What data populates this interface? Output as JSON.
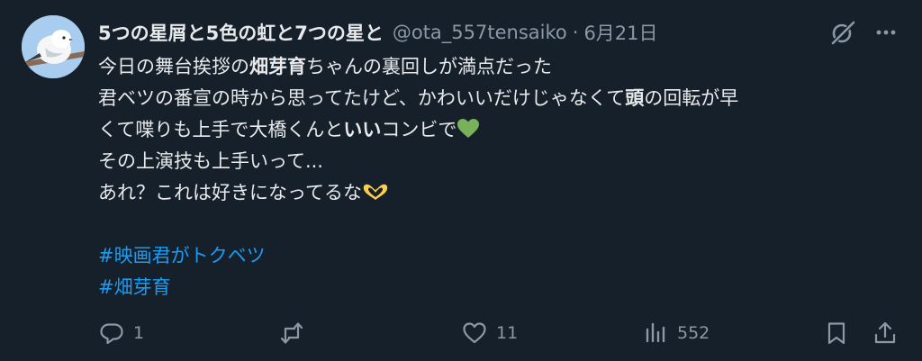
{
  "author": {
    "display_name": "5つの星屑と5色の虹と7つの星と",
    "handle": "@ota_557tensaiko",
    "separator": "·",
    "date": "6月21日",
    "avatar_icon": "bird-avatar"
  },
  "body": {
    "line1": {
      "a": "今日の舞台挨拶の",
      "b": "畑芽育",
      "c": "ちゃんの裏回しが満点だった"
    },
    "line2": {
      "a": "君ベツの番宣の時から思ってたけど、かわいいだけじゃなくて",
      "b": "頭",
      "c": "の回転が早"
    },
    "line3": {
      "a": "くて喋りも上手で大橋くんと",
      "b": "いい",
      "c": "コンビで",
      "emoji": "green-heart"
    },
    "line4": "その上演技も上手いって...",
    "line5": {
      "a": "あれ？これは好きになってるな",
      "emoji": "heart-hands"
    },
    "hashtags": [
      "#映画君がトクベツ",
      "#畑芽育"
    ]
  },
  "actions": {
    "reply_count": "1",
    "retweet_count": "",
    "like_count": "11",
    "view_count": "552"
  },
  "colors": {
    "background": "#15202b",
    "text": "#e7e9ea",
    "secondary": "#8b98a5",
    "link": "#1d9bf0",
    "heart_green": "#78b159",
    "hands_yellow": "#ffcc4d"
  }
}
